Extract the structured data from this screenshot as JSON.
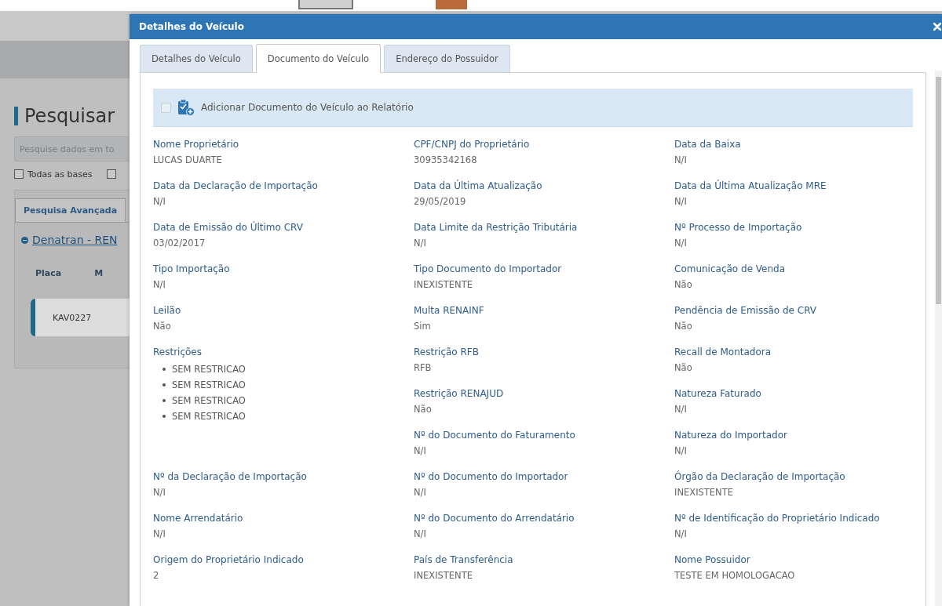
{
  "page": {
    "heading": "Pesquisar",
    "search": {
      "placeholder": "Pesquise dados em to"
    },
    "filters": [
      {
        "label": "Todas as bases",
        "checked": false
      },
      {
        "checked": false
      }
    ],
    "tabs": [
      {
        "label": "Pesquisa Avançada",
        "selected": true
      }
    ],
    "source": {
      "label": "Denatran - REN",
      "expanded": true
    },
    "table": {
      "columns": [
        "Placa",
        "M"
      ],
      "rows": [
        {
          "cells": [
            "KAV0227"
          ],
          "selected": true
        }
      ]
    }
  },
  "dialog": {
    "title": "Detalhes do Veículo",
    "tabs": [
      {
        "label": "Detalhes do Veículo",
        "selected": false
      },
      {
        "label": "Documento do Veículo",
        "selected": true
      },
      {
        "label": "Endereço do Possuidor",
        "selected": false
      }
    ],
    "report_option": {
      "label": "Adicionar Documento do Veículo ao Relatório",
      "checked": false
    },
    "fields": [
      {
        "label": "Nome Proprietário",
        "value": "LUCAS DUARTE"
      },
      {
        "label": "CPF/CNPJ do Proprietário",
        "value": "30935342168"
      },
      {
        "label": "Data da Baixa",
        "value": "N/I"
      },
      {
        "label": "Data da Declaração de Importação",
        "value": "N/I"
      },
      {
        "label": "Data da Última Atualização",
        "value": "29/05/2019"
      },
      {
        "label": "Data da Última Atualização MRE",
        "value": "N/I"
      },
      {
        "label": "Data de Emissão do Último CRV",
        "value": "03/02/2017"
      },
      {
        "label": "Data Limite da Restrição Tributária",
        "value": "N/I"
      },
      {
        "label": "Nº Processo de Importação",
        "value": "N/I"
      },
      {
        "label": "Tipo Importação",
        "value": "N/I"
      },
      {
        "label": "Tipo Documento do Importador",
        "value": "INEXISTENTE"
      },
      {
        "label": "Comunicação de Venda",
        "value": "Não"
      },
      {
        "label": "Leilão",
        "value": "Não"
      },
      {
        "label": "Multa RENAINF",
        "value": "Sim"
      },
      {
        "label": "Pendência de Emissão de CRV",
        "value": "Não"
      },
      {
        "kind": "list",
        "label": "Restrições",
        "items": [
          "SEM RESTRICAO",
          "SEM RESTRICAO",
          "SEM RESTRICAO",
          "SEM RESTRICAO"
        ]
      },
      {
        "label": "Restrição RFB",
        "value": "RFB"
      },
      {
        "label": "Recall de Montadora",
        "value": "Não"
      },
      {
        "label": "Restrição RENAJUD",
        "value": "Não"
      },
      {
        "label": "Natureza Faturado",
        "value": "N/I"
      },
      {
        "label": "Nº do Documento do Faturamento",
        "value": "N/I"
      },
      {
        "label": "Natureza do Importador",
        "value": "N/I"
      },
      {
        "label": "Nº da Declaração de Importação",
        "value": "N/I"
      },
      {
        "label": "Nº do Documento do Importador",
        "value": "N/I"
      },
      {
        "label": "Órgão da Declaração de Importação",
        "value": "INEXISTENTE"
      },
      {
        "label": "Nome Arrendatário",
        "value": "N/I"
      },
      {
        "label": "Nº do Documento do Arrendatário",
        "value": "N/I"
      },
      {
        "label": "Nº de Identificação do Proprietário Indicado",
        "value": "N/I"
      },
      {
        "label": "Origem do Proprietário Indicado",
        "value": "2"
      },
      {
        "label": "País de Transferência",
        "value": "INEXISTENTE"
      },
      {
        "label": "Nome Possuidor",
        "value": "TESTE EM HOMOLOGACAO"
      }
    ]
  }
}
